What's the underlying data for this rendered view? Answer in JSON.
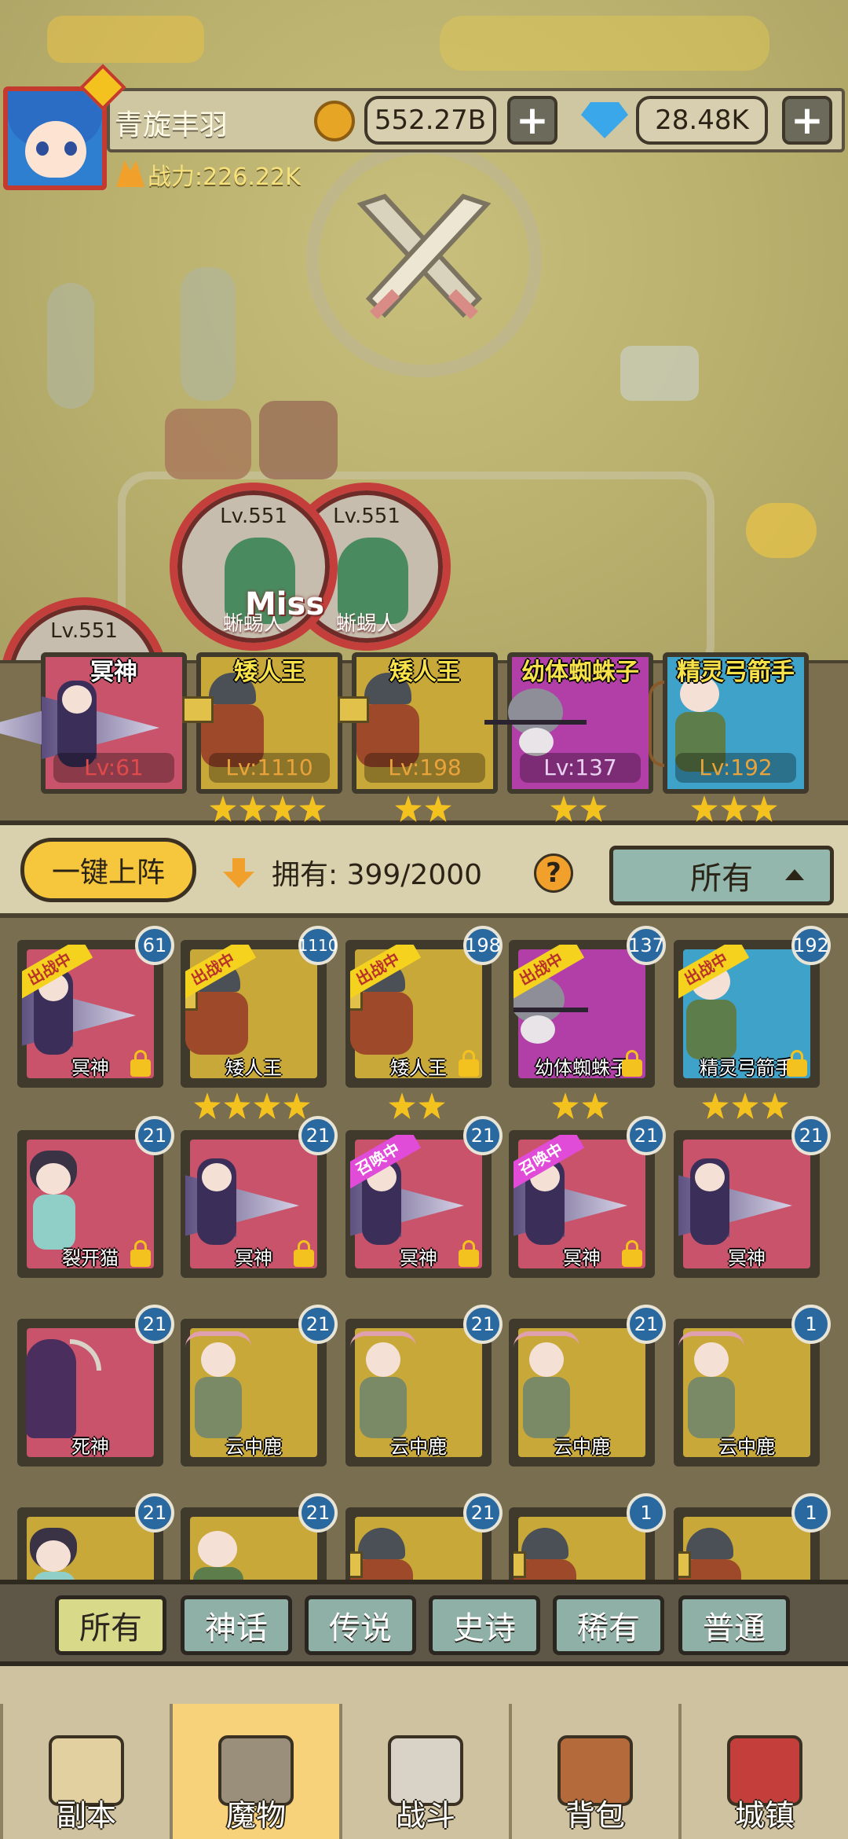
{
  "player": {
    "name": "青旋丰羽",
    "coins": "552.27B",
    "gems": "28.48K",
    "power_label": "战力:226.22K"
  },
  "battle": {
    "enemies": [
      {
        "level": "Lv.551",
        "name": "蜥蜴人"
      },
      {
        "level": "Lv.551",
        "name": "蜥蜴人"
      },
      {
        "level": "Lv.551",
        "name": ""
      }
    ],
    "miss_text": "Miss"
  },
  "team": [
    {
      "name": "冥神",
      "level": "Lv:61",
      "stars": 0,
      "color": "#c8536a"
    },
    {
      "name": "矮人王",
      "level": "Lv:1110",
      "stars": 4,
      "color": "#c9a83a"
    },
    {
      "name": "矮人王",
      "level": "Lv:198",
      "stars": 2,
      "color": "#c9a83a"
    },
    {
      "name": "幼体蜘蛛子",
      "level": "Lv:137",
      "stars": 2,
      "color": "#b23fa8"
    },
    {
      "name": "精灵弓箭手",
      "level": "Lv:192",
      "stars": 3,
      "color": "#3fa2c9"
    }
  ],
  "toolbar": {
    "deploy_label": "一键上阵",
    "owned_label": "拥有:",
    "owned_count": "399/2000",
    "help": "?",
    "filter_value": "所有"
  },
  "cards": [
    {
      "name": "冥神",
      "badge": "61",
      "ribbon": "出战中",
      "locked": true,
      "color": "#c8536a",
      "stars": 0,
      "kind": "wing"
    },
    {
      "name": "矮人王",
      "badge": "1110",
      "ribbon": "出战中",
      "locked": false,
      "color": "#c9a83a",
      "stars": 4,
      "kind": "dwarf"
    },
    {
      "name": "矮人王",
      "badge": "198",
      "ribbon": "出战中",
      "locked": true,
      "color": "#c9a83a",
      "stars": 2,
      "kind": "dwarf"
    },
    {
      "name": "幼体蜘蛛子",
      "badge": "137",
      "ribbon": "出战中",
      "locked": true,
      "color": "#b23fa8",
      "stars": 2,
      "kind": "spider"
    },
    {
      "name": "精灵弓箭手",
      "badge": "192",
      "ribbon": "出战中",
      "locked": true,
      "color": "#3fa2c9",
      "stars": 3,
      "kind": "elf"
    },
    {
      "name": "裂开猫",
      "badge": "21",
      "ribbon": "",
      "locked": true,
      "color": "#c8536a",
      "stars": 0,
      "kind": "cat"
    },
    {
      "name": "冥神",
      "badge": "21",
      "ribbon": "",
      "locked": true,
      "color": "#c8536a",
      "stars": 0,
      "kind": "wing"
    },
    {
      "name": "冥神",
      "badge": "21",
      "ribbon": "召唤中",
      "locked": true,
      "color": "#c8536a",
      "stars": 0,
      "kind": "wing"
    },
    {
      "name": "冥神",
      "badge": "21",
      "ribbon": "召唤中",
      "locked": true,
      "color": "#c8536a",
      "stars": 0,
      "kind": "wing"
    },
    {
      "name": "冥神",
      "badge": "21",
      "ribbon": "",
      "locked": false,
      "color": "#c8536a",
      "stars": 0,
      "kind": "wing"
    },
    {
      "name": "死神",
      "badge": "21",
      "ribbon": "",
      "locked": false,
      "color": "#c8536a",
      "stars": 0,
      "kind": "reaper"
    },
    {
      "name": "云中鹿",
      "badge": "21",
      "ribbon": "",
      "locked": false,
      "color": "#c9a83a",
      "stars": 0,
      "kind": "deer"
    },
    {
      "name": "云中鹿",
      "badge": "21",
      "ribbon": "",
      "locked": false,
      "color": "#c9a83a",
      "stars": 0,
      "kind": "deer"
    },
    {
      "name": "云中鹿",
      "badge": "21",
      "ribbon": "",
      "locked": false,
      "color": "#c9a83a",
      "stars": 0,
      "kind": "deer"
    },
    {
      "name": "云中鹿",
      "badge": "1",
      "ribbon": "",
      "locked": false,
      "color": "#c9a83a",
      "stars": 0,
      "kind": "deer"
    },
    {
      "name": "",
      "badge": "21",
      "ribbon": "",
      "locked": false,
      "color": "#c9a83a",
      "stars": 0,
      "kind": "cat"
    },
    {
      "name": "",
      "badge": "21",
      "ribbon": "",
      "locked": false,
      "color": "#c9a83a",
      "stars": 0,
      "kind": "elf"
    },
    {
      "name": "",
      "badge": "21",
      "ribbon": "",
      "locked": false,
      "color": "#c9a83a",
      "stars": 0,
      "kind": "dwarf"
    },
    {
      "name": "",
      "badge": "1",
      "ribbon": "",
      "locked": false,
      "color": "#c9a83a",
      "stars": 0,
      "kind": "dwarf"
    },
    {
      "name": "",
      "badge": "1",
      "ribbon": "",
      "locked": false,
      "color": "#c9a83a",
      "stars": 0,
      "kind": "dwarf"
    }
  ],
  "rarity_tabs": [
    {
      "label": "所有",
      "active": true
    },
    {
      "label": "神话",
      "active": false
    },
    {
      "label": "传说",
      "active": false
    },
    {
      "label": "史诗",
      "active": false
    },
    {
      "label": "稀有",
      "active": false
    },
    {
      "label": "普通",
      "active": false
    }
  ],
  "nav": [
    {
      "label": "副本",
      "icon": "map-icon",
      "active": false
    },
    {
      "label": "魔物",
      "icon": "monster-helmet-icon",
      "active": true
    },
    {
      "label": "战斗",
      "icon": "crossed-swords-icon",
      "active": false
    },
    {
      "label": "背包",
      "icon": "backpack-icon",
      "active": false
    },
    {
      "label": "城镇",
      "icon": "town-shop-icon",
      "active": false
    }
  ]
}
